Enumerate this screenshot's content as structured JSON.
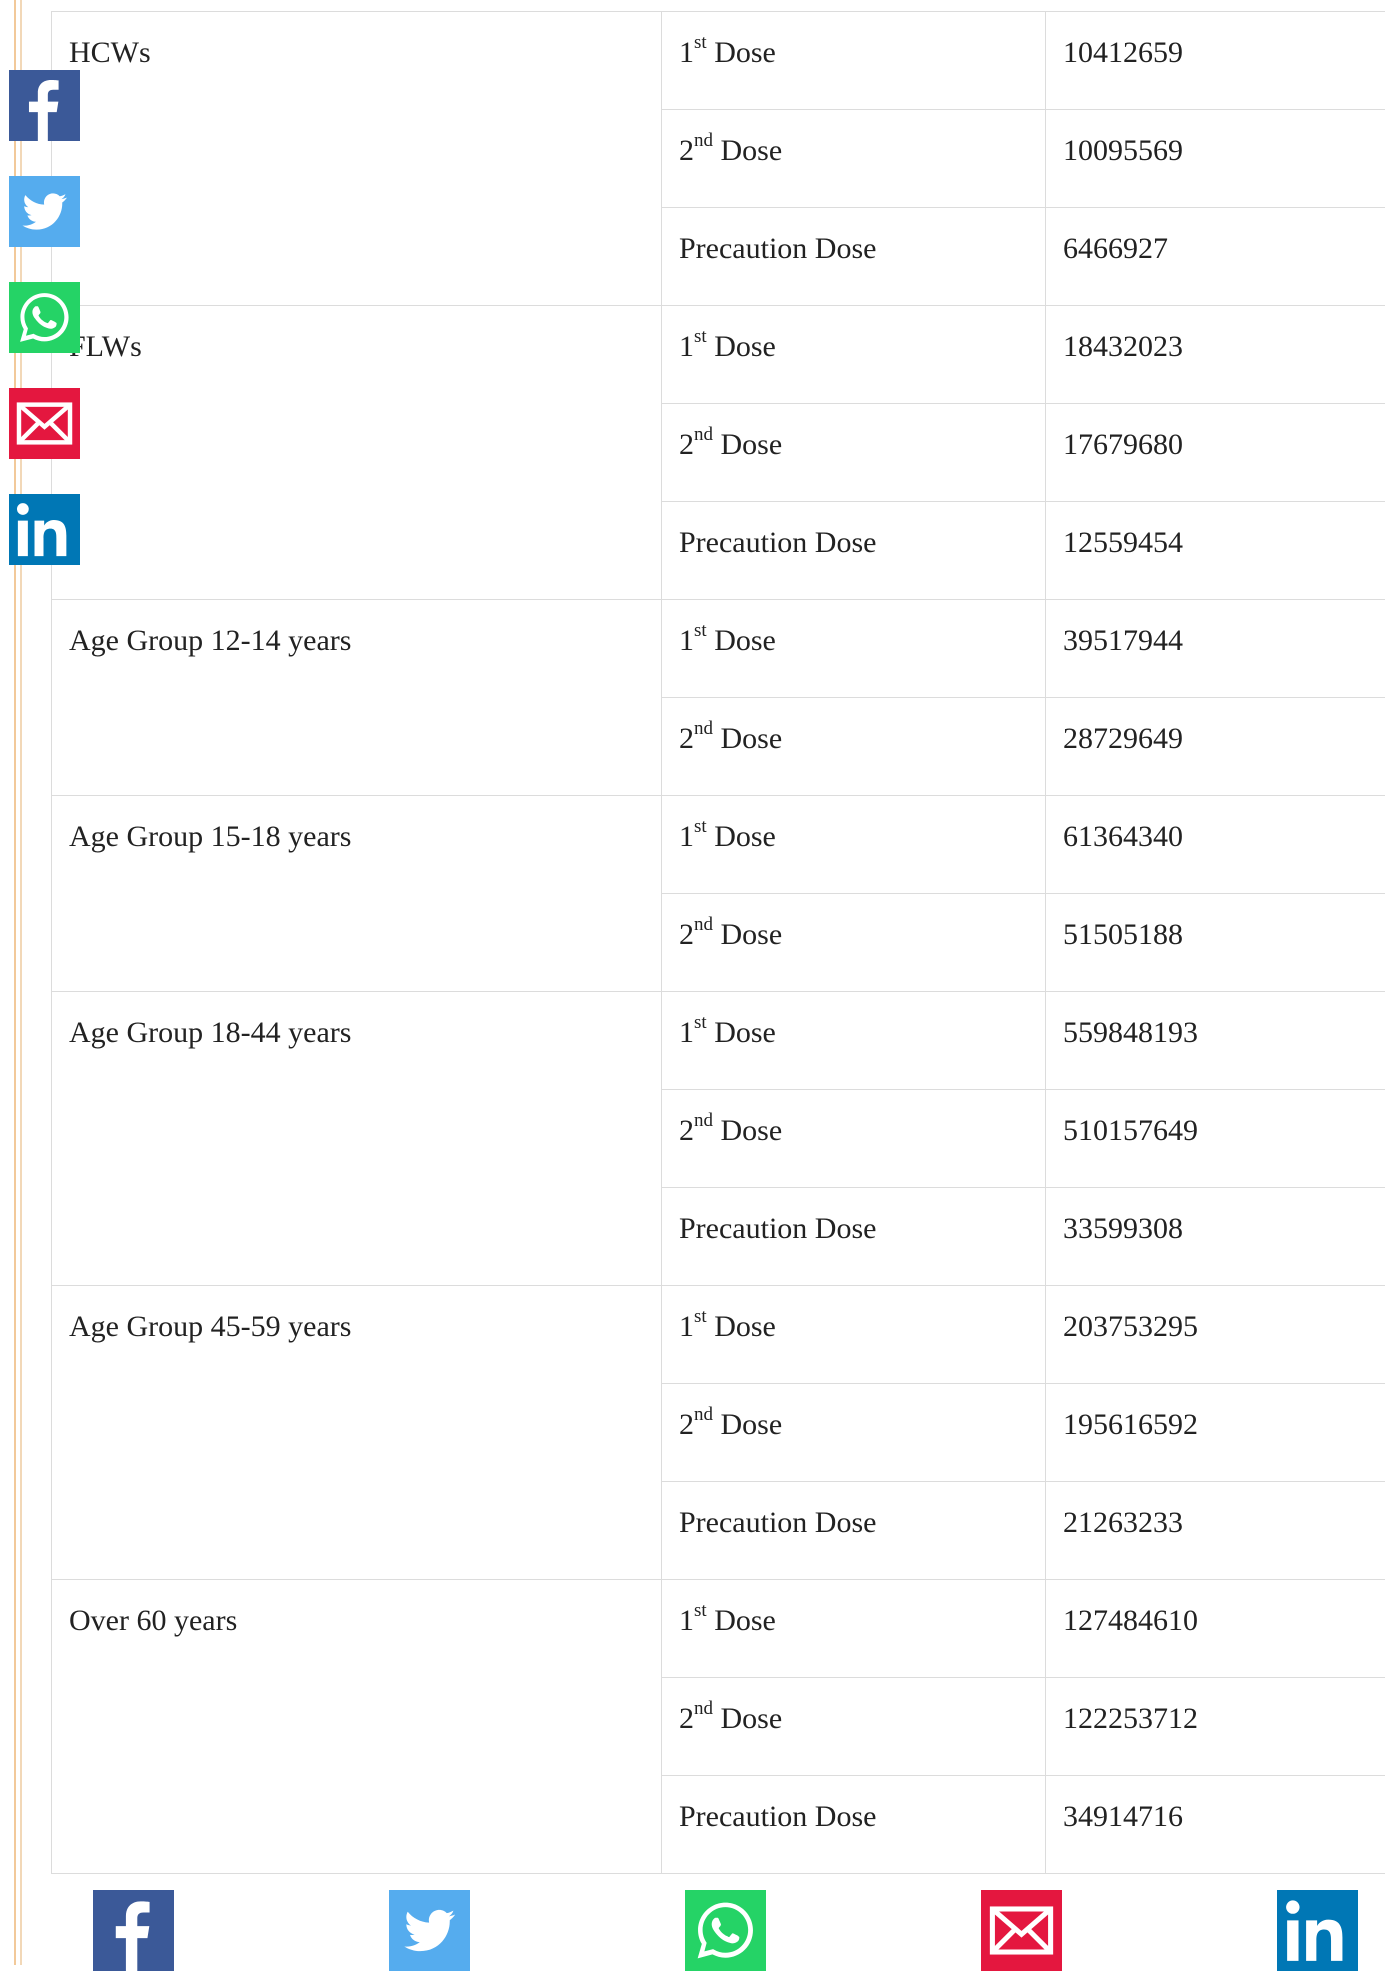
{
  "colors": {
    "facebook": "#3b5998",
    "twitter": "#55acee",
    "whatsapp": "#25d366",
    "email": "#e4173f",
    "linkedin": "#0077b5",
    "border": "#dcdcdc"
  },
  "share": {
    "side": [
      {
        "icon": "facebook-icon",
        "label": "Facebook"
      },
      {
        "icon": "twitter-icon",
        "label": "Twitter"
      },
      {
        "icon": "whatsapp-icon",
        "label": "WhatsApp"
      },
      {
        "icon": "email-icon",
        "label": "Email"
      },
      {
        "icon": "linkedin-icon",
        "label": "LinkedIn"
      }
    ],
    "bottom": [
      {
        "icon": "facebook-icon",
        "label": "Facebook"
      },
      {
        "icon": "twitter-icon",
        "label": "Twitter"
      },
      {
        "icon": "whatsapp-icon",
        "label": "WhatsApp"
      },
      {
        "icon": "email-icon",
        "label": "Email"
      },
      {
        "icon": "linkedin-icon",
        "label": "LinkedIn"
      }
    ]
  },
  "table": {
    "groups": [
      {
        "name": "HCWs",
        "rows": [
          {
            "ordinal": "1",
            "suffix": "st",
            "dose": "Dose",
            "value": "10412659"
          },
          {
            "ordinal": "2",
            "suffix": "nd",
            "dose": "Dose",
            "value": "10095569"
          },
          {
            "ordinal": "",
            "suffix": "",
            "dose": "Precaution Dose",
            "value": "6466927"
          }
        ]
      },
      {
        "name": "FLWs",
        "rows": [
          {
            "ordinal": "1",
            "suffix": "st",
            "dose": "Dose",
            "value": "18432023"
          },
          {
            "ordinal": "2",
            "suffix": "nd",
            "dose": "Dose",
            "value": "17679680"
          },
          {
            "ordinal": "",
            "suffix": "",
            "dose": "Precaution Dose",
            "value": "12559454"
          }
        ]
      },
      {
        "name": "Age Group 12-14 years",
        "rows": [
          {
            "ordinal": "1",
            "suffix": "st",
            "dose": "Dose",
            "value": "39517944"
          },
          {
            "ordinal": "2",
            "suffix": "nd",
            "dose": "Dose",
            "value": "28729649"
          }
        ]
      },
      {
        "name": "Age Group 15-18 years",
        "rows": [
          {
            "ordinal": "1",
            "suffix": "st",
            "dose": "Dose",
            "value": "61364340"
          },
          {
            "ordinal": "2",
            "suffix": "nd",
            "dose": "Dose",
            "value": "51505188"
          }
        ]
      },
      {
        "name": "Age Group 18-44 years",
        "rows": [
          {
            "ordinal": "1",
            "suffix": "st",
            "dose": "Dose",
            "value": "559848193"
          },
          {
            "ordinal": "2",
            "suffix": "nd",
            "dose": "Dose",
            "value": "510157649"
          },
          {
            "ordinal": "",
            "suffix": "",
            "dose": "Precaution Dose",
            "value": "33599308"
          }
        ]
      },
      {
        "name": "Age Group 45-59 years",
        "rows": [
          {
            "ordinal": "1",
            "suffix": "st",
            "dose": "Dose",
            "value": "203753295"
          },
          {
            "ordinal": "2",
            "suffix": "nd",
            "dose": "Dose",
            "value": "195616592"
          },
          {
            "ordinal": "",
            "suffix": "",
            "dose": "Precaution Dose",
            "value": "21263233"
          }
        ]
      },
      {
        "name": "Over 60 years",
        "rows": [
          {
            "ordinal": "1",
            "suffix": "st",
            "dose": "Dose",
            "value": "127484610"
          },
          {
            "ordinal": "2",
            "suffix": "nd",
            "dose": "Dose",
            "value": "122253712"
          },
          {
            "ordinal": "",
            "suffix": "",
            "dose": "Precaution Dose",
            "value": "34914716"
          }
        ]
      }
    ]
  }
}
